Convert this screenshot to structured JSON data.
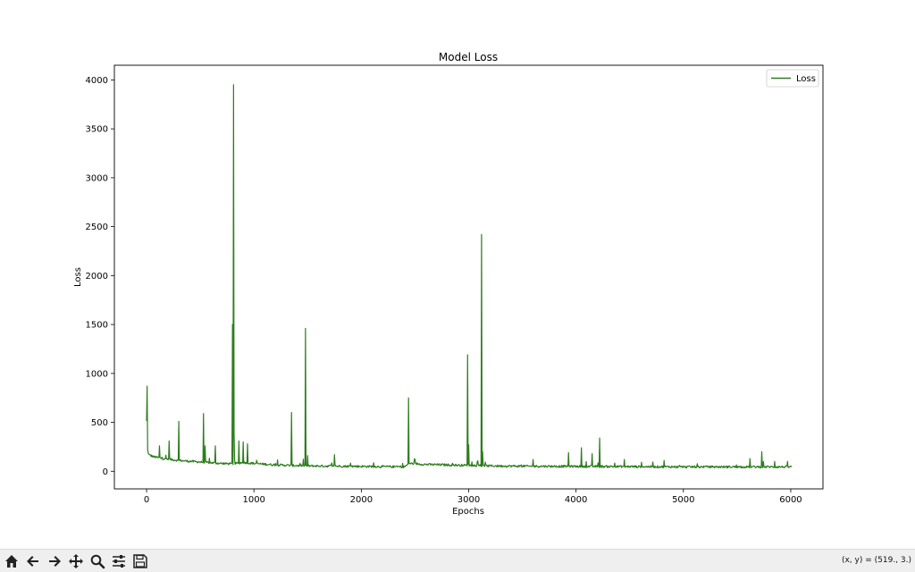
{
  "toolbar": {
    "buttons": [
      {
        "name": "home-icon",
        "label": "Home"
      },
      {
        "name": "back-arrow-icon",
        "label": "Back"
      },
      {
        "name": "forward-arrow-icon",
        "label": "Forward"
      },
      {
        "name": "pan-icon",
        "label": "Pan"
      },
      {
        "name": "zoom-icon",
        "label": "Zoom"
      },
      {
        "name": "configure-subplots-icon",
        "label": "Configure subplots"
      },
      {
        "name": "save-icon",
        "label": "Save"
      }
    ],
    "coordinates": "(x, y) = (519., 3.)"
  },
  "chart_data": {
    "type": "line",
    "title": "Model Loss",
    "xlabel": "Epochs",
    "ylabel": "Loss",
    "xlim": [
      -300,
      6300
    ],
    "ylim": [
      -180,
      4150
    ],
    "xticks": [
      0,
      1000,
      2000,
      3000,
      4000,
      5000,
      6000
    ],
    "yticks": [
      0,
      500,
      1000,
      1500,
      2000,
      2500,
      3000,
      3500,
      4000
    ],
    "legend": "top-right",
    "grid": false,
    "series": [
      {
        "name": "Loss",
        "color": "#2e7d1e",
        "baseline": [
          [
            0,
            510
          ],
          [
            10,
            220
          ],
          [
            20,
            170
          ],
          [
            60,
            150
          ],
          [
            150,
            130
          ],
          [
            300,
            110
          ],
          [
            500,
            95
          ],
          [
            700,
            80
          ],
          [
            800,
            75
          ],
          [
            900,
            90
          ],
          [
            1000,
            80
          ],
          [
            1200,
            65
          ],
          [
            1500,
            55
          ],
          [
            2000,
            50
          ],
          [
            2400,
            45
          ],
          [
            2450,
            80
          ],
          [
            2600,
            70
          ],
          [
            3000,
            60
          ],
          [
            3200,
            55
          ],
          [
            3500,
            52
          ],
          [
            4000,
            50
          ],
          [
            4500,
            48
          ],
          [
            5000,
            45
          ],
          [
            5500,
            45
          ],
          [
            6000,
            45
          ]
        ],
        "spikes": [
          [
            5,
            870
          ],
          [
            120,
            260
          ],
          [
            210,
            310
          ],
          [
            300,
            510
          ],
          [
            530,
            590
          ],
          [
            545,
            260
          ],
          [
            640,
            260
          ],
          [
            800,
            1500
          ],
          [
            810,
            3950
          ],
          [
            815,
            380
          ],
          [
            860,
            310
          ],
          [
            900,
            300
          ],
          [
            940,
            280
          ],
          [
            1350,
            600
          ],
          [
            1480,
            1460
          ],
          [
            1500,
            160
          ],
          [
            1750,
            170
          ],
          [
            2440,
            750
          ],
          [
            2990,
            1190
          ],
          [
            3000,
            270
          ],
          [
            3120,
            2420
          ],
          [
            3130,
            200
          ],
          [
            3600,
            120
          ],
          [
            3930,
            190
          ],
          [
            4050,
            240
          ],
          [
            4150,
            180
          ],
          [
            4220,
            340
          ],
          [
            4450,
            120
          ],
          [
            4820,
            110
          ],
          [
            5620,
            130
          ],
          [
            5730,
            200
          ],
          [
            5850,
            100
          ]
        ]
      }
    ]
  }
}
